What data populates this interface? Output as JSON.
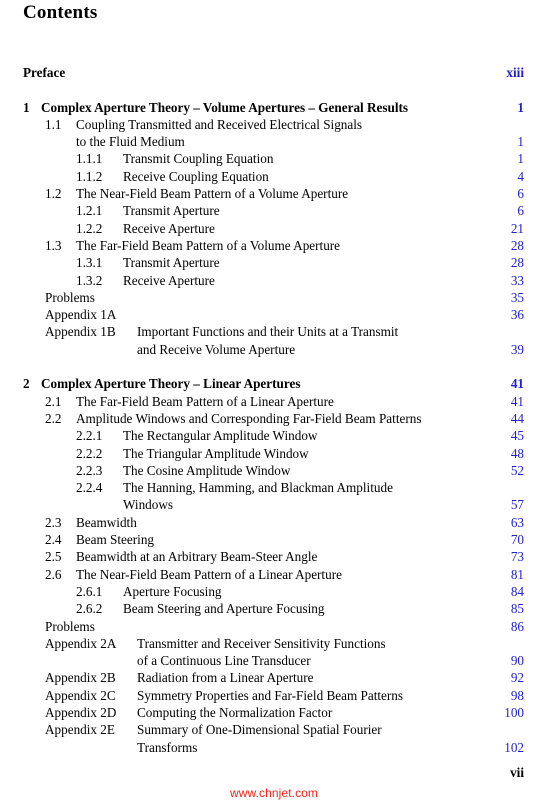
{
  "page": {
    "title": "Contents",
    "folio": "vii",
    "watermark": "www.chnjet.com",
    "page_number_color": "#2321cc",
    "watermark_color": "#f4251c",
    "text_color": "#000000"
  },
  "entries": [
    {
      "level": "front",
      "number": "",
      "label": "Preface",
      "page": "xiii",
      "cont": ""
    },
    {
      "level": "chap",
      "number": "1",
      "label": "Complex Aperture Theory – Volume Apertures – General Results",
      "page": "1",
      "cont": "",
      "gap_before": true
    },
    {
      "level": "sec",
      "number": "1.1",
      "label": "Coupling Transmitted and Received Electrical Signals",
      "page": "",
      "cont": ""
    },
    {
      "level": "sec",
      "number": "",
      "label": "",
      "page": "1",
      "cont": "to the Fluid Medium"
    },
    {
      "level": "sub",
      "number": "1.1.1",
      "label": "Transmit Coupling Equation",
      "page": "1",
      "cont": ""
    },
    {
      "level": "sub",
      "number": "1.1.2",
      "label": "Receive Coupling Equation",
      "page": "4",
      "cont": ""
    },
    {
      "level": "sec",
      "number": "1.2",
      "label": "The Near-Field Beam Pattern of a Volume Aperture",
      "page": "6",
      "cont": ""
    },
    {
      "level": "sub",
      "number": "1.2.1",
      "label": "Transmit Aperture",
      "page": "6",
      "cont": ""
    },
    {
      "level": "sub",
      "number": "1.2.2",
      "label": "Receive Aperture",
      "page": "21",
      "cont": ""
    },
    {
      "level": "sec",
      "number": "1.3",
      "label": "The Far-Field Beam Pattern of a Volume Aperture",
      "page": "28",
      "cont": ""
    },
    {
      "level": "sub",
      "number": "1.3.1",
      "label": "Transmit Aperture",
      "page": "28",
      "cont": ""
    },
    {
      "level": "sub",
      "number": "1.3.2",
      "label": "Receive Aperture",
      "page": "33",
      "cont": ""
    },
    {
      "level": "plain",
      "number": "",
      "label": "Problems",
      "page": "35",
      "cont": ""
    },
    {
      "level": "app",
      "number": "Appendix 1A",
      "label": "",
      "page": "36",
      "cont": ""
    },
    {
      "level": "app",
      "number": "Appendix 1B",
      "label": "Important Functions and their Units at a Transmit",
      "page": "",
      "cont": ""
    },
    {
      "level": "app",
      "number": "",
      "label": "",
      "page": "39",
      "cont": "and Receive Volume Aperture"
    },
    {
      "level": "chap",
      "number": "2",
      "label": "Complex Aperture Theory – Linear Apertures",
      "page": "41",
      "cont": "",
      "gap_before": true
    },
    {
      "level": "sec",
      "number": "2.1",
      "label": "The Far-Field Beam Pattern of a Linear Aperture",
      "page": "41",
      "cont": ""
    },
    {
      "level": "sec",
      "number": "2.2",
      "label": "Amplitude Windows and Corresponding Far-Field Beam Patterns",
      "page": "44",
      "cont": ""
    },
    {
      "level": "sub",
      "number": "2.2.1",
      "label": "The Rectangular Amplitude Window",
      "page": "45",
      "cont": ""
    },
    {
      "level": "sub",
      "number": "2.2.2",
      "label": "The Triangular Amplitude Window",
      "page": "48",
      "cont": ""
    },
    {
      "level": "sub",
      "number": "2.2.3",
      "label": "The Cosine Amplitude Window",
      "page": "52",
      "cont": ""
    },
    {
      "level": "sub",
      "number": "2.2.4",
      "label": "The Hanning, Hamming, and Blackman Amplitude",
      "page": "",
      "cont": ""
    },
    {
      "level": "sub",
      "number": "",
      "label": "",
      "page": "57",
      "cont": "Windows"
    },
    {
      "level": "sec",
      "number": "2.3",
      "label": "Beamwidth",
      "page": "63",
      "cont": ""
    },
    {
      "level": "sec",
      "number": "2.4",
      "label": "Beam Steering",
      "page": "70",
      "cont": ""
    },
    {
      "level": "sec",
      "number": "2.5",
      "label": "Beamwidth at an Arbitrary Beam-Steer Angle",
      "page": "73",
      "cont": ""
    },
    {
      "level": "sec",
      "number": "2.6",
      "label": "The Near-Field Beam Pattern of a Linear Aperture",
      "page": "81",
      "cont": ""
    },
    {
      "level": "sub",
      "number": "2.6.1",
      "label": "Aperture Focusing",
      "page": "84",
      "cont": ""
    },
    {
      "level": "sub",
      "number": "2.6.2",
      "label": "Beam Steering and Aperture Focusing",
      "page": "85",
      "cont": ""
    },
    {
      "level": "plain",
      "number": "",
      "label": "Problems",
      "page": "86",
      "cont": ""
    },
    {
      "level": "app",
      "number": "Appendix 2A",
      "label": "Transmitter and Receiver Sensitivity Functions",
      "page": "",
      "cont": ""
    },
    {
      "level": "app",
      "number": "",
      "label": "",
      "page": "90",
      "cont": "of a Continuous Line Transducer"
    },
    {
      "level": "app",
      "number": "Appendix 2B",
      "label": "Radiation from a Linear Aperture",
      "page": "92",
      "cont": ""
    },
    {
      "level": "app",
      "number": "Appendix 2C",
      "label": "Symmetry Properties and Far-Field Beam Patterns",
      "page": "98",
      "cont": ""
    },
    {
      "level": "app",
      "number": "Appendix 2D",
      "label": "Computing the Normalization Factor",
      "page": "100",
      "cont": ""
    },
    {
      "level": "app",
      "number": "Appendix 2E",
      "label": "Summary of One-Dimensional Spatial Fourier",
      "page": "",
      "cont": ""
    },
    {
      "level": "app",
      "number": "",
      "label": "",
      "page": "102",
      "cont": "Transforms"
    }
  ]
}
